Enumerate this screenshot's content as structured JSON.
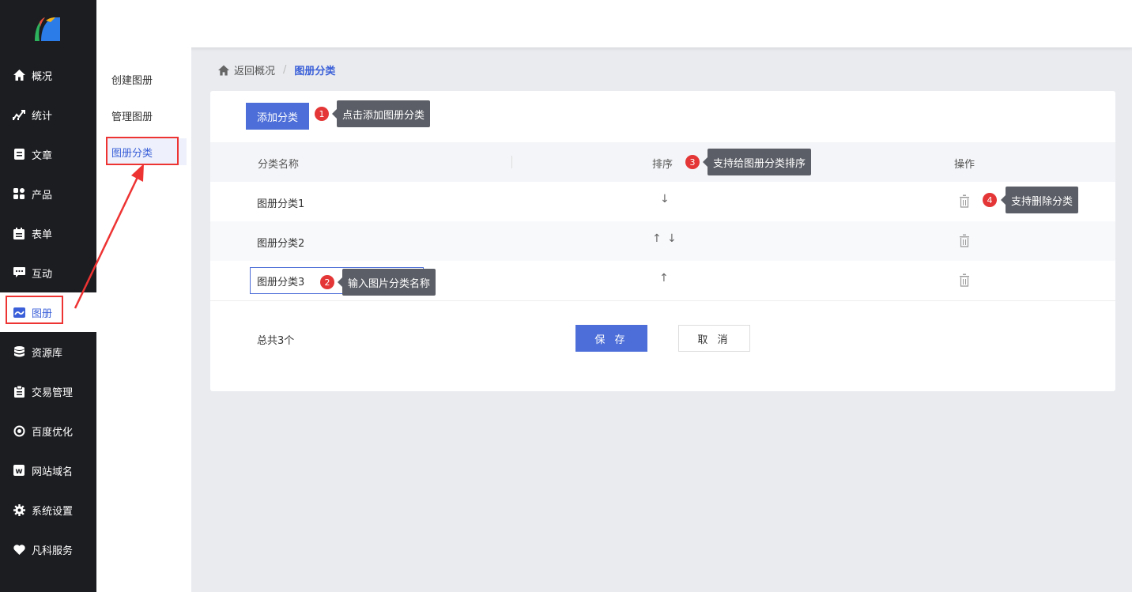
{
  "nav": {
    "items": [
      {
        "label": "概况",
        "icon": "home-icon"
      },
      {
        "label": "统计",
        "icon": "chart-icon"
      },
      {
        "label": "文章",
        "icon": "article-icon"
      },
      {
        "label": "产品",
        "icon": "grid-icon"
      },
      {
        "label": "表单",
        "icon": "form-icon"
      },
      {
        "label": "互动",
        "icon": "chat-icon"
      },
      {
        "label": "图册",
        "icon": "album-icon"
      },
      {
        "label": "资源库",
        "icon": "database-icon"
      },
      {
        "label": "交易管理",
        "icon": "clipboard-icon"
      },
      {
        "label": "百度优化",
        "icon": "seo-icon"
      },
      {
        "label": "网站域名",
        "icon": "domain-icon"
      },
      {
        "label": "系统设置",
        "icon": "gear-icon"
      },
      {
        "label": "凡科服务",
        "icon": "heart-icon"
      }
    ],
    "active": "图册"
  },
  "submenu": {
    "items": [
      "创建图册",
      "管理图册",
      "图册分类"
    ],
    "active": "图册分类"
  },
  "breadcrumb": {
    "back": "返回概况",
    "current": "图册分类"
  },
  "toolbar": {
    "add_label": "添加分类"
  },
  "table": {
    "headers": {
      "name": "分类名称",
      "sort": "排序",
      "action": "操作"
    },
    "rows": [
      {
        "name": "图册分类1",
        "sort_up": false,
        "sort_down": true
      },
      {
        "name": "图册分类2",
        "sort_up": true,
        "sort_down": true
      },
      {
        "name": "图册分类3",
        "sort_up": true,
        "sort_down": false,
        "editing": true
      }
    ],
    "arrow_up": "↑",
    "arrow_down": "↓"
  },
  "footer": {
    "total": "总共3个",
    "save_label": "保 存",
    "cancel_label": "取 消"
  },
  "annotations": [
    {
      "num": "1",
      "text": "点击添加图册分类"
    },
    {
      "num": "2",
      "text": "输入图片分类名称"
    },
    {
      "num": "3",
      "text": "支持给图册分类排序"
    },
    {
      "num": "4",
      "text": "支持删除分类"
    }
  ],
  "colors": {
    "accent": "#4d6ed8",
    "sidebar_bg": "#1c1d21",
    "annotation_red": "#e43636",
    "tooltip_bg": "#5b5e66"
  }
}
